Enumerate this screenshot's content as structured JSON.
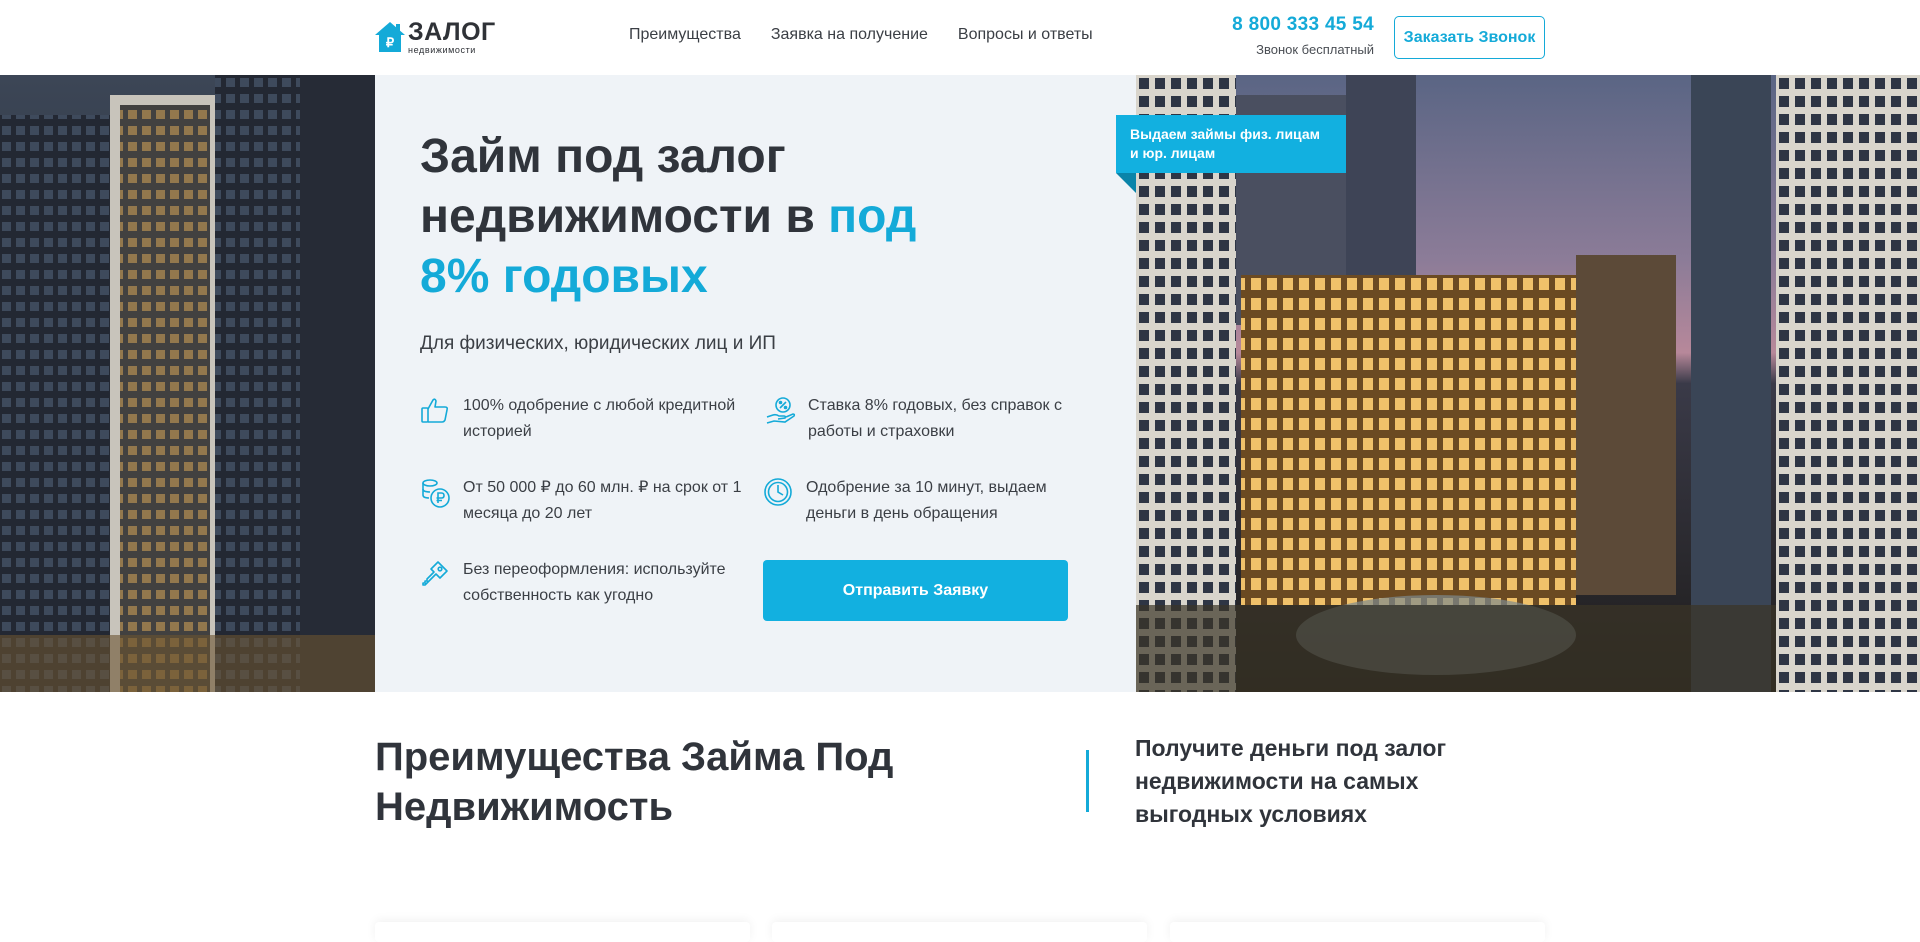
{
  "header": {
    "logo_main": "ЗАЛОГ",
    "logo_sub": "недвижимости",
    "nav": [
      {
        "label": "Преимущества"
      },
      {
        "label": "Заявка на получение"
      },
      {
        "label": "Вопросы и ответы"
      }
    ],
    "phone": "8 800 333 45 54",
    "phone_note": "Звонок бесплатный",
    "call_button": "Заказать Звонок"
  },
  "hero": {
    "title_part1": "Займ под залог недвижимости в ",
    "title_accent": "под 8% годовых",
    "subtitle": "Для физических, юридических лиц и ИП",
    "ribbon": "Выдаем займы физ. лицам и юр. лицам",
    "features": [
      {
        "icon": "thumbs-up-icon",
        "text": "100% одобрение с любой кредитной историей"
      },
      {
        "icon": "percent-hand-icon",
        "text": "Ставка 8% годовых, без справок с работы и страховки"
      },
      {
        "icon": "coins-ruble-icon",
        "text": "От 50 000 ₽ до 60 млн. ₽ на срок от 1 месяца до 20 лет"
      },
      {
        "icon": "clock-icon",
        "text": "Одобрение за 10 минут, выдаем деньги в день обращения"
      },
      {
        "icon": "key-icon",
        "text": "Без переоформления: используйте собственность как угодно"
      }
    ],
    "submit_button": "Отправить Заявку"
  },
  "advantages": {
    "title": "Преимущества Займа Под Недвижимость",
    "note": "Получите деньги под залог недвижимости на самых выгодных условиях"
  },
  "colors": {
    "accent": "#14aad8",
    "text_dark": "#30343b",
    "panel_bg": "#eff3f7"
  }
}
